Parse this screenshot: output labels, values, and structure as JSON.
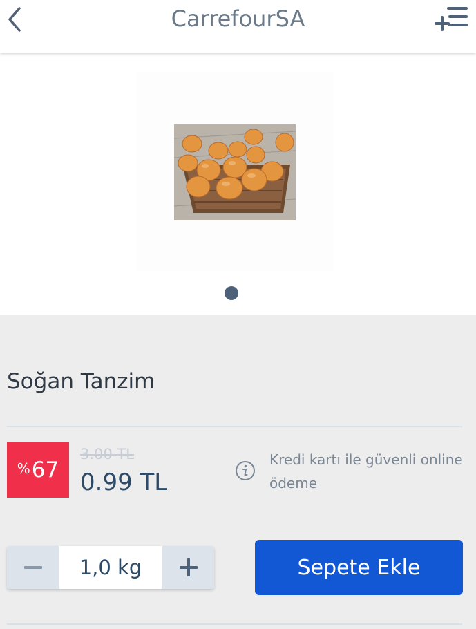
{
  "header": {
    "title": "CarrefourSA",
    "back_icon": "chevron-left-icon",
    "list_add_icon": "add-to-list-icon"
  },
  "gallery": {
    "image_alt": "onions in a woven basket",
    "total_slides": 1,
    "active_slide": 1
  },
  "product": {
    "name": "Soğan Tanzim",
    "discount_symbol": "%",
    "discount_value": "67",
    "old_price": "3.00 TL",
    "new_price": "0.99 TL",
    "payment_info": "Kredi kartı ile güvenli online ödeme"
  },
  "quantity": {
    "decrement_icon": "minus-icon",
    "value": "1,0 kg",
    "increment_icon": "plus-icon"
  },
  "actions": {
    "add_to_cart_label": "Sepete Ekle"
  },
  "colors": {
    "brand_blue": "#1257d4",
    "discount_red": "#f0304b",
    "price_text": "#2d4a66"
  }
}
